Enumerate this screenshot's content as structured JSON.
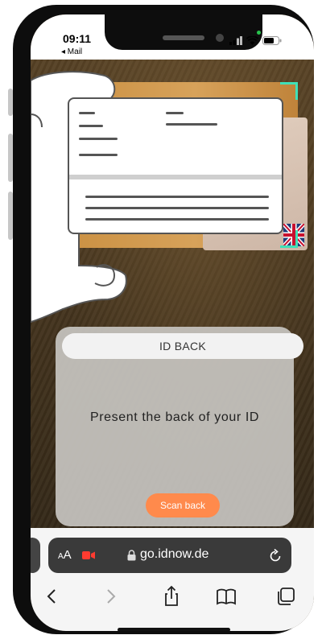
{
  "status_bar": {
    "time": "09:11",
    "back_app": "◂ Mail"
  },
  "scan_prompt": {
    "tab_label": "ID BACK",
    "instruction": "Present the back of your ID",
    "scan_button": "Scan back"
  },
  "browser": {
    "text_size_small": "A",
    "text_size_large": "A",
    "url": "go.idnow.de",
    "toolbar_icons": [
      "back-icon",
      "forward-icon",
      "share-icon",
      "bookmarks-icon",
      "tabs-icon"
    ]
  },
  "colors": {
    "accent_orange": "#ff8a4c",
    "scan_frame": "#3fe0b8",
    "recording_red": "#ff3b30"
  }
}
